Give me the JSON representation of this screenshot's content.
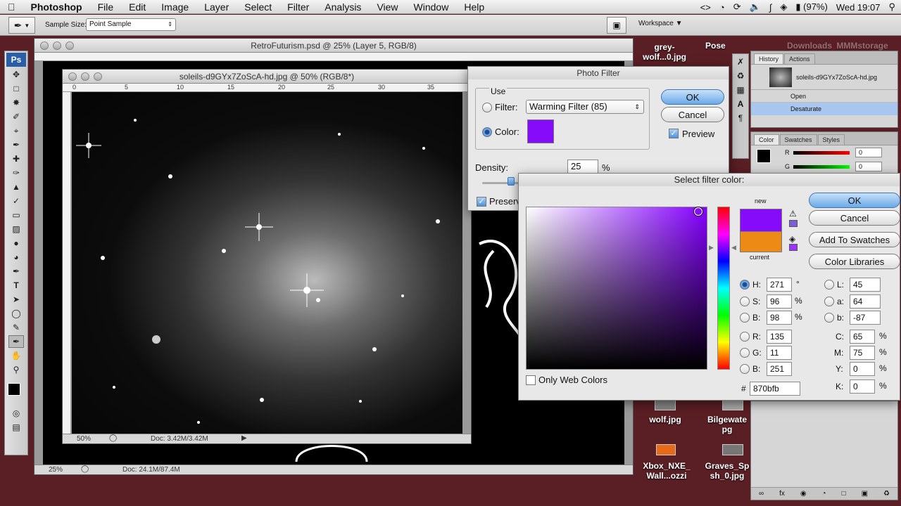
{
  "menubar": {
    "app": "Photoshop",
    "items": [
      "File",
      "Edit",
      "Image",
      "Layer",
      "Select",
      "Filter",
      "Analysis",
      "View",
      "Window",
      "Help"
    ],
    "battery": "(97%)",
    "clock": "Wed 19:07"
  },
  "options": {
    "sample_label": "Sample Size:",
    "sample_value": "Point Sample",
    "workspace": "Workspace"
  },
  "doc_back": {
    "title": "RetroFuturism.psd @ 25% (Layer 5, RGB/8)",
    "zoom": "25%",
    "doc": "Doc: 24.1M/87.4M"
  },
  "doc_front": {
    "title": "soleils-d9GYx7ZoScA-hd.jpg @ 50% (RGB/8*)",
    "zoom": "50%",
    "doc": "Doc: 3.42M/3.42M",
    "ruler": [
      "0",
      "5",
      "10",
      "15",
      "20",
      "25",
      "30",
      "35"
    ]
  },
  "photo_filter": {
    "title": "Photo Filter",
    "use": "Use",
    "filter_label": "Filter:",
    "filter_value": "Warming Filter (85)",
    "color_label": "Color:",
    "density_label": "Density:",
    "density_value": "25",
    "percent": "%",
    "preserve": "Preserv",
    "ok": "OK",
    "cancel": "Cancel",
    "preview": "Preview",
    "swatch_color": "#870bfb"
  },
  "picker": {
    "title": "Select filter color:",
    "new_label": "new",
    "current_label": "current",
    "new_color": "#870bfb",
    "current_color": "#ec8a15",
    "ok": "OK",
    "cancel": "Cancel",
    "add_swatches": "Add To Swatches",
    "libraries": "Color Libraries",
    "only_web": "Only Web Colors",
    "H": {
      "label": "H:",
      "value": "271",
      "unit": "°"
    },
    "S": {
      "label": "S:",
      "value": "96",
      "unit": "%"
    },
    "Bv": {
      "label": "B:",
      "value": "98",
      "unit": "%"
    },
    "R": {
      "label": "R:",
      "value": "135"
    },
    "G": {
      "label": "G:",
      "value": "11"
    },
    "Bc": {
      "label": "B:",
      "value": "251"
    },
    "L": {
      "label": "L:",
      "value": "45"
    },
    "a": {
      "label": "a:",
      "value": "64"
    },
    "b": {
      "label": "b:",
      "value": "-87"
    },
    "C": {
      "label": "C:",
      "value": "65",
      "unit": "%"
    },
    "M": {
      "label": "M:",
      "value": "75",
      "unit": "%"
    },
    "Y": {
      "label": "Y:",
      "value": "0",
      "unit": "%"
    },
    "K": {
      "label": "K:",
      "value": "0",
      "unit": "%"
    },
    "hex_label": "#",
    "hex": "870bfb"
  },
  "history": {
    "tabs": [
      "History",
      "Actions"
    ],
    "snapshot": "soleils-d9GYx7ZoScA-hd.jpg",
    "items": [
      "Open",
      "Desaturate"
    ]
  },
  "colorpanel": {
    "tabs": [
      "Color",
      "Swatches",
      "Styles"
    ],
    "r_label": "R",
    "g_label": "G",
    "r": "0",
    "g": "0"
  },
  "desktop": {
    "icons": [
      "grey-wolf...0.jpg",
      "Pose",
      "Downloads",
      "MMMstorage",
      "wolf.jpg",
      "Bilgewate pg",
      "Xbox_NXE_ Wall...ozzi",
      "Graves_Sp sh_0.jpg"
    ]
  }
}
